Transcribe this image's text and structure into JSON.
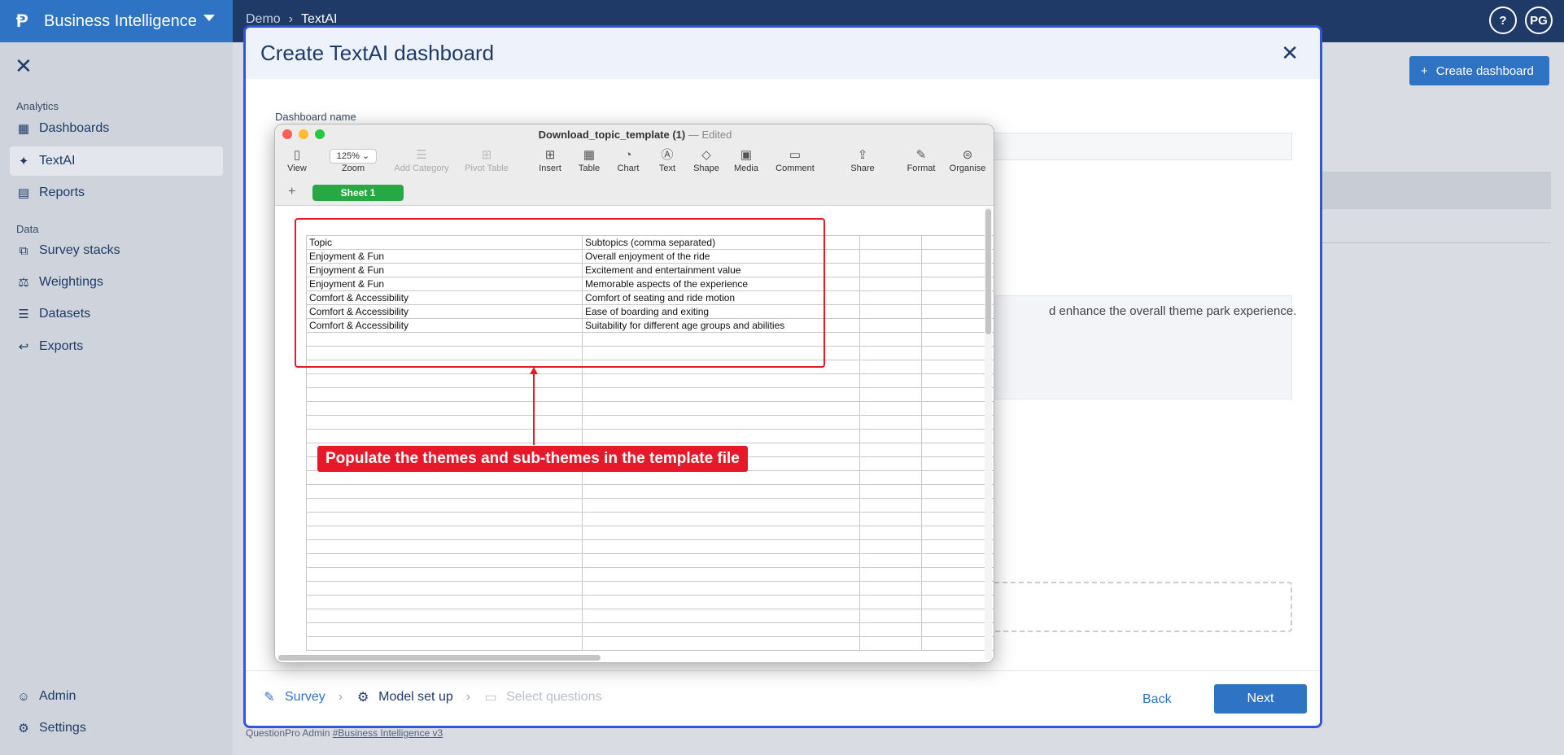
{
  "app": {
    "brand_title": "Business Intelligence",
    "breadcrumb": [
      "Demo",
      "TextAI"
    ],
    "help_label": "?",
    "user_initials": "PG"
  },
  "sidebar": {
    "sections": {
      "analytics": "Analytics",
      "data": "Data"
    },
    "items": [
      {
        "label": "Dashboards",
        "icon": "dashboards-icon"
      },
      {
        "label": "TextAI",
        "icon": "sparkle-icon",
        "active": true
      },
      {
        "label": "Reports",
        "icon": "report-icon"
      },
      {
        "label": "Survey stacks",
        "icon": "survey-stacks-icon"
      },
      {
        "label": "Weightings",
        "icon": "scale-icon"
      },
      {
        "label": "Datasets",
        "icon": "list-icon"
      },
      {
        "label": "Exports",
        "icon": "export-icon"
      },
      {
        "label": "Admin",
        "icon": "user-icon"
      },
      {
        "label": "Settings",
        "icon": "gear-icon"
      }
    ]
  },
  "background": {
    "create_dashboard_label": "Create dashboard",
    "footer_text": "QuestionPro Admin",
    "footer_link": "#Business Intelligence v3"
  },
  "modal": {
    "title": "Create TextAI dashboard",
    "dashboard_name_label": "Dashboard name",
    "description_visible_text": "d enhance the overall theme park experience.",
    "steps": [
      {
        "label": "Survey",
        "state": "done"
      },
      {
        "label": "Model set up",
        "state": "current"
      },
      {
        "label": "Select questions",
        "state": "disabled"
      }
    ],
    "back_label": "Back",
    "next_label": "Next"
  },
  "numbers": {
    "file_name": "Download_topic_template (1)",
    "edited_label": "— Edited",
    "zoom_value": "125%",
    "toolbar": [
      {
        "label": "View",
        "icon": "sidebar-icon",
        "disabled": false
      },
      {
        "label": "Zoom",
        "icon": "zoom-icon",
        "disabled": false
      },
      {
        "label": "Add Category",
        "icon": "category-icon",
        "disabled": true
      },
      {
        "label": "Pivot Table",
        "icon": "pivot-icon",
        "disabled": true
      },
      {
        "label": "Insert",
        "icon": "insert-icon",
        "disabled": false
      },
      {
        "label": "Table",
        "icon": "table-icon",
        "disabled": false
      },
      {
        "label": "Chart",
        "icon": "chart-icon",
        "disabled": false
      },
      {
        "label": "Text",
        "icon": "text-icon",
        "disabled": false
      },
      {
        "label": "Shape",
        "icon": "shape-icon",
        "disabled": false
      },
      {
        "label": "Media",
        "icon": "media-icon",
        "disabled": false
      },
      {
        "label": "Comment",
        "icon": "comment-icon",
        "disabled": false
      },
      {
        "label": "Share",
        "icon": "share-icon",
        "disabled": false
      },
      {
        "label": "Format",
        "icon": "format-icon",
        "disabled": false
      },
      {
        "label": "Organise",
        "icon": "organise-icon",
        "disabled": false
      }
    ],
    "sheet_tab": "Sheet 1",
    "table": {
      "headers": [
        "Topic",
        "Subtopics (comma separated)"
      ],
      "rows": [
        [
          "Enjoyment & Fun",
          "Overall enjoyment of the ride"
        ],
        [
          "Enjoyment & Fun",
          "Excitement and entertainment value"
        ],
        [
          "Enjoyment & Fun",
          "Memorable aspects of the experience"
        ],
        [
          "Comfort & Accessibility",
          "Comfort of seating and ride motion"
        ],
        [
          "Comfort & Accessibility",
          "Ease of boarding and exiting"
        ],
        [
          "Comfort & Accessibility",
          "Suitability for different age groups and abilities"
        ]
      ]
    },
    "annotation": "Populate the themes and sub-themes in the template file",
    "annotation_color": "#e8182b"
  }
}
